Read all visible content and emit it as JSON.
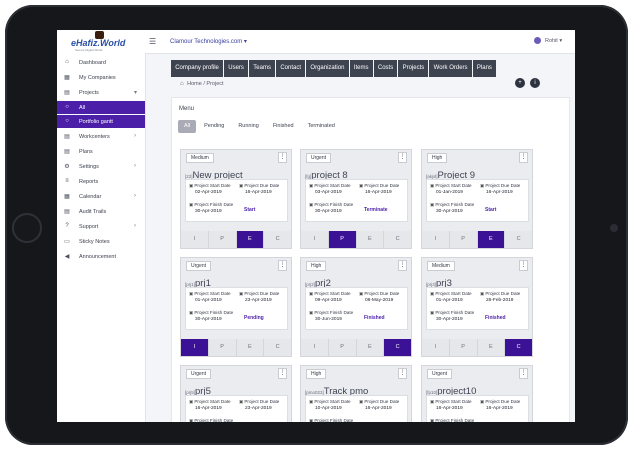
{
  "app": {
    "logo_text": "eHafiz.World",
    "logo_tagline": "Secure Digital World",
    "company": "Clamour Technologies.com ▾",
    "user": "Rohit ▾"
  },
  "sidebar": {
    "items": [
      {
        "label": "Dashboard",
        "icon": "⌂",
        "chevron": ""
      },
      {
        "label": "My Companies",
        "icon": "▦",
        "chevron": ""
      },
      {
        "label": "Projects",
        "icon": "▤",
        "chevron": "▾"
      },
      {
        "label": "All",
        "icon": "○",
        "chevron": ""
      },
      {
        "label": "Portfolio gantt",
        "icon": "○",
        "chevron": ""
      },
      {
        "label": "Workcenters",
        "icon": "▤",
        "chevron": "›"
      },
      {
        "label": "Plans",
        "icon": "▤",
        "chevron": ""
      },
      {
        "label": "Settings",
        "icon": "⚙",
        "chevron": "›"
      },
      {
        "label": "Reports",
        "icon": "≡",
        "chevron": ""
      },
      {
        "label": "Calendar",
        "icon": "▦",
        "chevron": "›"
      },
      {
        "label": "Audit Trails",
        "icon": "▤",
        "chevron": ""
      },
      {
        "label": "Support",
        "icon": "?",
        "chevron": "›"
      },
      {
        "label": "Sticky Notes",
        "icon": "▭",
        "chevron": ""
      },
      {
        "label": "Announcement",
        "icon": "◀",
        "chevron": ""
      }
    ]
  },
  "nav": {
    "tabs": [
      "Company profile",
      "Users",
      "Teams",
      "Contact",
      "Organization",
      "Items",
      "Costs",
      "Projects",
      "Work Orders",
      "Plans"
    ]
  },
  "breadcrumb": {
    "home": "Home",
    "sep": "/",
    "current": "Project"
  },
  "actions": {
    "add": "+",
    "info": "i"
  },
  "main": {
    "menu_label": "Menu",
    "filters": [
      "All",
      "Pending",
      "Running",
      "Finished",
      "Terminated"
    ]
  },
  "labels": {
    "start": "Project Start Date",
    "due": "Project Due Date",
    "finish": "Project Finish Date",
    "menu": "⋮"
  },
  "phase_labels": [
    "I",
    "P",
    "E",
    "C"
  ],
  "cards": [
    {
      "priority": "Medium",
      "id": "[22]",
      "name": "New project",
      "start": "02-Apr-2019",
      "due": "16-Apr-2019",
      "finish": "30-Apr-2019",
      "status": "Start",
      "phase": "E"
    },
    {
      "priority": "Urgent",
      "id": "[fg]",
      "name": "project 8",
      "start": "03-Apr-2019",
      "due": "16-Apr-2019",
      "finish": "30-Apr-2019",
      "status": "Terminate",
      "phase": "P"
    },
    {
      "priority": "High",
      "id": "[akjsl]",
      "name": "Project 9",
      "start": "01-Jan-2019",
      "due": "16-Apr-2019",
      "finish": "30-Apr-2019",
      "status": "Start",
      "phase": "E"
    },
    {
      "priority": "Urgent",
      "id": "[prj1]",
      "name": "prj1",
      "start": "01-Apr-2019",
      "due": "23-Apr-2019",
      "finish": "30-Apr-2019",
      "status": "Pending",
      "phase": "I"
    },
    {
      "priority": "High",
      "id": "[prj2]",
      "name": "prj2",
      "start": "09-Apr-2019",
      "due": "08-May-2019",
      "finish": "30-Jun-2019",
      "status": "Finished",
      "phase": "C"
    },
    {
      "priority": "Medium",
      "id": "[prj3]",
      "name": "prj3",
      "start": "01-Apr-2019",
      "due": "26-Feb-2019",
      "finish": "30-Apr-2019",
      "status": "Finished",
      "phase": "C"
    },
    {
      "priority": "Urgent",
      "id": "[prj5]",
      "name": "prj5",
      "start": "16-Apr-2019",
      "due": "23-Apr-2019",
      "finish": "",
      "status": "",
      "phase": ""
    },
    {
      "priority": "High",
      "id": "[pmo023]",
      "name": "Track pmo",
      "start": "10-Apr-2019",
      "due": "16-Apr-2019",
      "finish": "",
      "status": "",
      "phase": ""
    },
    {
      "priority": "Urgent",
      "id": "[fp10]",
      "name": "project10",
      "start": "16-Apr-2019",
      "due": "16-Apr-2019",
      "finish": "",
      "status": "",
      "phase": ""
    }
  ],
  "colors": {
    "accent": "#4b1fa8",
    "nav_bg": "#3e4350"
  }
}
